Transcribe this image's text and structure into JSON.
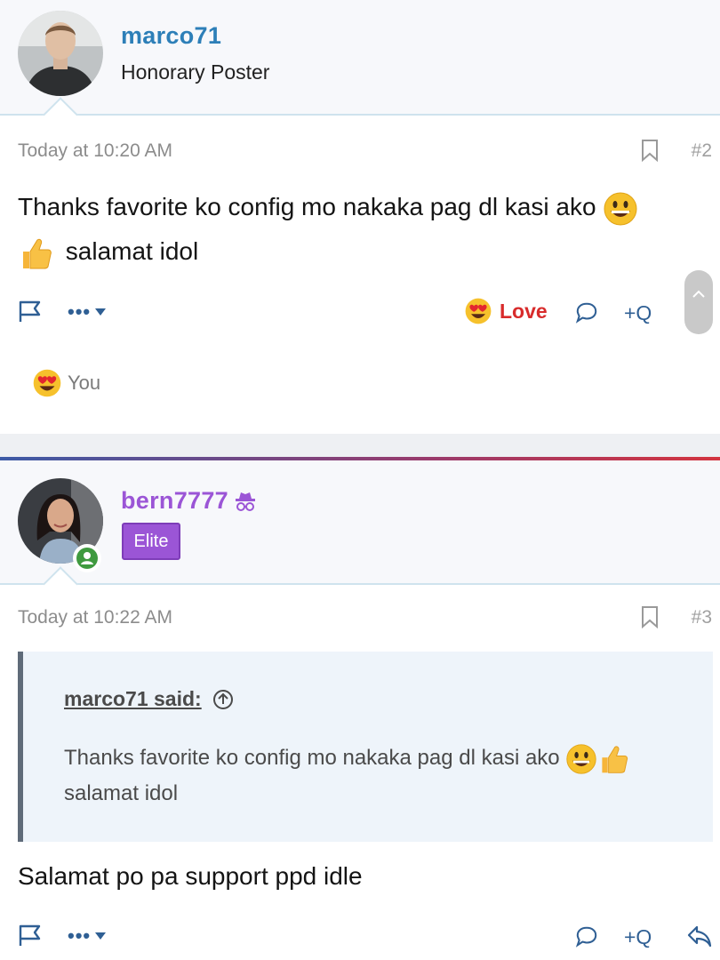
{
  "post1": {
    "username": "marco71",
    "user_title": "Honorary Poster",
    "time": "Today at 10:20 AM",
    "post_number": "#2",
    "body_line1": "Thanks favorite ko config mo nakaka pag dl kasi ako",
    "body_line2": "salamat idol",
    "reaction_label": "Love",
    "plusq": "+Q",
    "reaction_summary": "You",
    "username_color": "#2d7fb8"
  },
  "post2": {
    "username": "bern7777",
    "badge": "Elite",
    "time": "Today at 10:22 AM",
    "post_number": "#3",
    "quote_author": "marco71 said:",
    "quote_line1": "Thanks favorite ko config mo nakaka pag dl kasi ako",
    "quote_line2": "salamat idol",
    "body": "Salamat po pa support ppd idle",
    "plusq": "+Q",
    "username_color": "#9b55d6"
  },
  "colors": {
    "accent_blue": "#2f5f94",
    "love_red": "#d82b2b",
    "elite_purple": "#9b55d6"
  }
}
